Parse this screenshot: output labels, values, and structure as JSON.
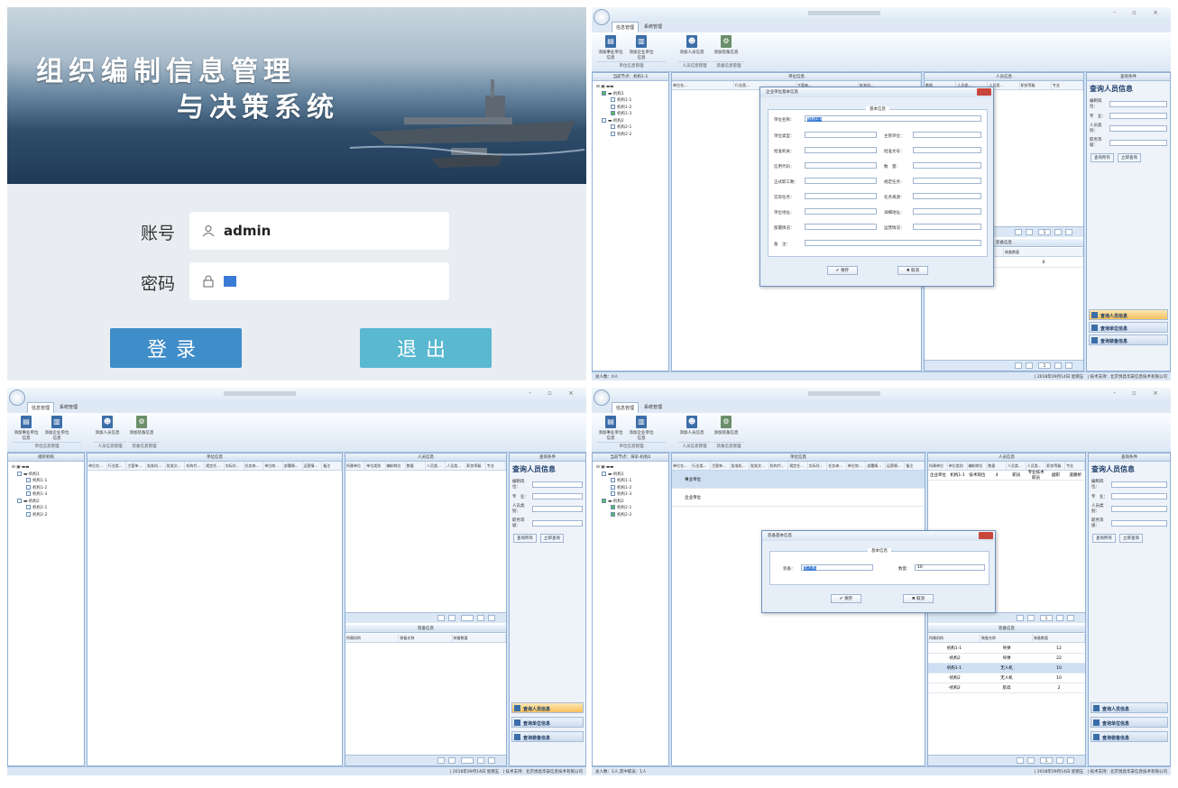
{
  "login": {
    "title_line1": "组织编制信息管理",
    "title_line2": "与决策系统",
    "account_label": "账号",
    "account_value": "admin",
    "password_label": "密码",
    "login_button": "登录",
    "exit_button": "退出"
  },
  "app": {
    "tabs": [
      "信息管理",
      "系统管理"
    ],
    "ribbon": {
      "btn1": "添加事业单位信息",
      "btn2": "添加企业单位信息",
      "btn3": "添加人员信息",
      "btn4": "添加装备信息",
      "group1": "单位信息管理",
      "group2": "人员信息管理",
      "group3": "装备信息管理"
    },
    "org_head": "组织机构",
    "current_node_2": "当前节点：机构1-1",
    "current_node_4": "当前节点：海军-机构2",
    "tree": [
      "机构1",
      "机构1-1",
      "机构1-2",
      "机构1-3",
      "机构2",
      "机构2-1",
      "机构2-2"
    ],
    "unit_head": "单位信息",
    "person_head": "人员信息",
    "equip_head": "装备信息",
    "query_head": "查询条件",
    "unit_cols": [
      "单位名...",
      "行业类...",
      "主管单...",
      "批准机...",
      "批准文...",
      "机构代...",
      "规定任...",
      "实际任...",
      "任务来...",
      "单位地...",
      "部署情...",
      "运营情...",
      "备注"
    ],
    "person_cols": [
      "所属单位",
      "单位类别",
      "编制岗位",
      "数量",
      "人员类...",
      "人员类...",
      "职务等级",
      "专业"
    ],
    "equip_cols": [
      "所属机构",
      "装备名称",
      "装备数量"
    ],
    "query": {
      "title": "查询人员信息",
      "f1": "编制岗位：",
      "f2": "专　业：",
      "f3": "人员类别：",
      "f4": "职务等级：",
      "b1": "查询所有",
      "b2": "立即查询"
    },
    "nav": [
      "查询人员信息",
      "查询单位信息",
      "查询装备信息"
    ],
    "status_left_2": "总人数：0人",
    "status_left_4": "总人数：1人,其中职员：1人",
    "status_date": "| 2018年09月14日 星期五",
    "status_support": "| 技术支持：北京悦昌华安信息技术有限公司",
    "unit_rows_4": [
      "事业单位",
      "企业单位"
    ],
    "person_row_4": [
      "企业单位",
      "机构1-1",
      "技术岗位",
      "4",
      "职员",
      "专业技术职员",
      "副职",
      "道路桥"
    ],
    "equip_row_2": [
      "",
      "装甲车",
      "0"
    ],
    "equip_rows_4": [
      [
        "机构1-1",
        "导弹",
        "12"
      ],
      [
        "-机构2",
        "导弹",
        "22"
      ],
      [
        "机构1-1",
        "无人机",
        "10"
      ],
      [
        "-机构2",
        "无人机",
        "10"
      ],
      [
        "-机构2",
        "航母",
        "2"
      ]
    ]
  },
  "dialog_unit": {
    "title": "企业单位基本信息",
    "group": "基本信息",
    "name_label": "单位名称：",
    "name_value": "机构1-1",
    "left_labels": [
      "单位类型：",
      "批准机关：",
      "信用代码：",
      "正式职工数：",
      "实际任务：",
      "单位地址：",
      "部署情况："
    ],
    "right_labels": [
      "主管单位：",
      "批准文号：",
      "数　量：",
      "规定任务：",
      "任务来源：",
      "详细地址：",
      "运营情况："
    ],
    "remark_label": "备　注：",
    "save": "保存",
    "cancel": "取消"
  },
  "dialog_equip": {
    "title": "装备基本信息",
    "group": "基本信息",
    "equip_label": "装备：",
    "equip_value": "无人机",
    "qty_label": "数量：",
    "qty_value": "10",
    "save": "保存",
    "cancel": "取消"
  },
  "pager_page": "1"
}
